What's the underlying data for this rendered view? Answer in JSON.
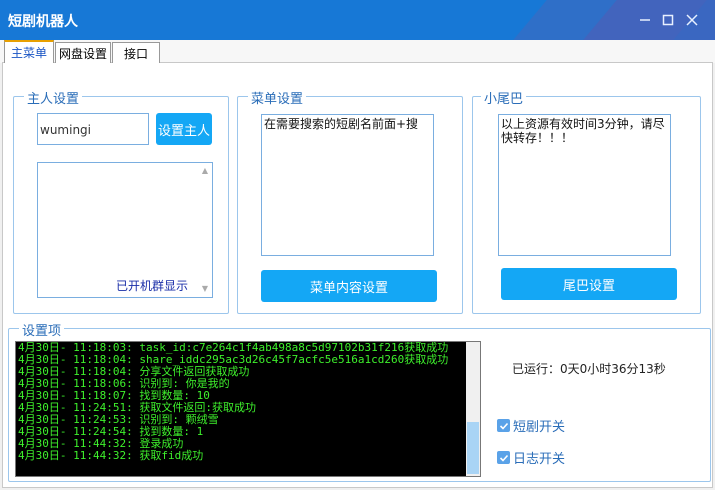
{
  "window": {
    "title": "短剧机器人"
  },
  "tabs": [
    {
      "label": "主菜单"
    },
    {
      "label": "网盘设置"
    },
    {
      "label": "接口"
    }
  ],
  "owner": {
    "group_label": "主人设置",
    "input_value": "wumingi",
    "set_button": "设置主人",
    "list_note": "已开机群显示"
  },
  "menu": {
    "group_label": "菜单设置",
    "content": "在需要搜索的短剧名前面+搜",
    "button": "菜单内容设置"
  },
  "tail": {
    "group_label": "小尾巴",
    "content": "以上资源有效时间3分钟，请尽快转存！！！",
    "button": "尾巴设置"
  },
  "settings": {
    "group_label": "设置项",
    "log": [
      "4月30日- 11:18:03: task_id:c7e264c1f4ab498a8c5d97102b31f216获取成功",
      "4月30日- 11:18:04: share_iddc295ac3d26c45f7acfc5e516a1cd260获取成功",
      "4月30日- 11:18:04: 分享文件返回获取成功",
      "4月30日- 11:18:06: 识别到: 你是我的",
      "4月30日- 11:18:07: 找到数量: 10",
      "4月30日- 11:24:51: 获取文件返回:获取成功",
      "4月30日- 11:24:53: 识别到: 颗绒雪",
      "4月30日- 11:24:54: 找到数量: 1",
      "4月30日- 11:44:32: 登录成功",
      "4月30日- 11:44:32: 获取fid成功"
    ],
    "uptime": "已运行：0天0小时36分13秒",
    "toggle_short": "短剧开关",
    "toggle_log": "日志开关"
  }
}
